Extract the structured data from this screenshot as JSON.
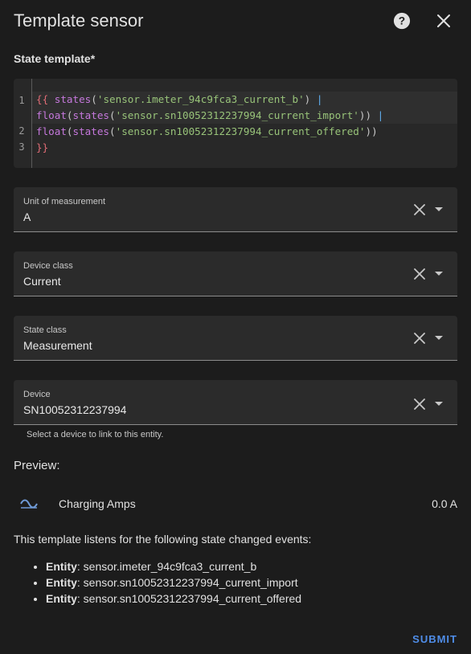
{
  "dialog": {
    "title": "Template sensor",
    "help_icon": "help-circle-icon",
    "close_icon": "close-icon"
  },
  "state_template": {
    "label": "State template*",
    "line_numbers": [
      "1",
      "2",
      "3"
    ],
    "lines": {
      "l1": {
        "open": "{{",
        "fn": "states",
        "p1": "(",
        "str": "'sensor.imeter_94c9fca3_current_b'",
        "p2": ")",
        "pipe": "|"
      },
      "l1b": {
        "fn1": "float",
        "p1": "(",
        "fn2": "states",
        "p2": "(",
        "str": "'sensor.sn10052312237994_current_import'",
        "p3": "))",
        "pipe": "|"
      },
      "l2": {
        "fn1": "float",
        "p1": "(",
        "fn2": "states",
        "p2": "(",
        "str": "'sensor.sn10052312237994_current_offered'",
        "p3": "))"
      },
      "l3": {
        "close": "}}"
      }
    }
  },
  "fields": {
    "unit": {
      "label": "Unit of measurement",
      "value": "A"
    },
    "device_class": {
      "label": "Device class",
      "value": "Current"
    },
    "state_class": {
      "label": "State class",
      "value": "Measurement"
    },
    "device": {
      "label": "Device",
      "value": "SN10052312237994",
      "helper": "Select a device to link to this entity."
    }
  },
  "preview": {
    "title": "Preview:",
    "icon": "sine-wave-icon",
    "entity_name": "Charging Amps",
    "state": "0.0 A"
  },
  "listens": {
    "text": "This template listens for the following state changed events:",
    "entities": [
      {
        "label": "Entity",
        "id": ": sensor.imeter_94c9fca3_current_b"
      },
      {
        "label": "Entity",
        "id": ": sensor.sn10052312237994_current_import"
      },
      {
        "label": "Entity",
        "id": ": sensor.sn10052312237994_current_offered"
      }
    ]
  },
  "actions": {
    "submit": "SUBMIT"
  },
  "colors": {
    "background": "#1c1c1c",
    "field": "#2b2b2b",
    "accent": "#4f8de8"
  }
}
